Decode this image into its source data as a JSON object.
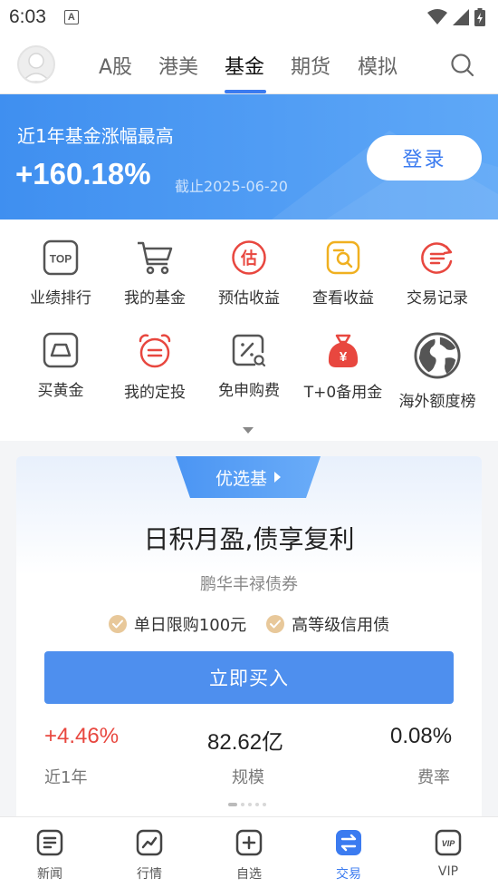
{
  "status_bar": {
    "time": "6:03",
    "a_icon": "A"
  },
  "top_nav": {
    "tabs": [
      {
        "label": "A股",
        "active": false
      },
      {
        "label": "港美",
        "active": false
      },
      {
        "label": "基金",
        "active": true
      },
      {
        "label": "期货",
        "active": false
      },
      {
        "label": "模拟",
        "active": false
      }
    ]
  },
  "banner": {
    "title": "近1年基金涨幅最高",
    "value": "+160.18%",
    "date": "截止2025-06-20",
    "login_label": "登录"
  },
  "grid": {
    "items": [
      {
        "label": "业绩排行",
        "icon": "top-icon",
        "color": "#555555",
        "icon_text": "TOP"
      },
      {
        "label": "我的基金",
        "icon": "cart-icon",
        "color": "#555555"
      },
      {
        "label": "预估收益",
        "icon": "estimate-icon",
        "color": "#e8473f",
        "icon_text": "估"
      },
      {
        "label": "查看收益",
        "icon": "search-doc-icon",
        "color": "#f0b020"
      },
      {
        "label": "交易记录",
        "icon": "record-icon",
        "color": "#e8473f"
      },
      {
        "label": "买黄金",
        "icon": "gold-icon",
        "color": "#555555"
      },
      {
        "label": "我的定投",
        "icon": "alarm-icon",
        "color": "#e8473f"
      },
      {
        "label": "免申购费",
        "icon": "discount-icon",
        "color": "#555555"
      },
      {
        "label": "T+0备用金",
        "icon": "money-bag-icon",
        "color": "#e8473f",
        "icon_text": "¥"
      },
      {
        "label": "海外额度榜",
        "icon": "globe-icon",
        "color": "#555555"
      }
    ]
  },
  "card": {
    "tag": "优选基",
    "title": "日积月盈,债享复利",
    "fund_name": "鹏华丰禄债券",
    "features": [
      "单日限购100元",
      "高等级信用债"
    ],
    "buy_label": "立即买入",
    "stats": [
      {
        "value": "+4.46%",
        "label": "近1年"
      },
      {
        "value": "82.62亿",
        "label": "规模"
      },
      {
        "value": "0.08%",
        "label": "费率"
      }
    ]
  },
  "bottom_nav": {
    "items": [
      {
        "label": "新闻",
        "icon": "news-icon",
        "active": false
      },
      {
        "label": "行情",
        "icon": "market-icon",
        "active": false
      },
      {
        "label": "自选",
        "icon": "watchlist-icon",
        "active": false
      },
      {
        "label": "交易",
        "icon": "trade-icon",
        "active": true
      },
      {
        "label": "VIP",
        "icon": "vip-icon",
        "active": false,
        "icon_text": "VIP"
      }
    ]
  },
  "colors": {
    "accent": "#3b7bf0",
    "up": "#e8473f",
    "gold": "#e8c89a"
  }
}
